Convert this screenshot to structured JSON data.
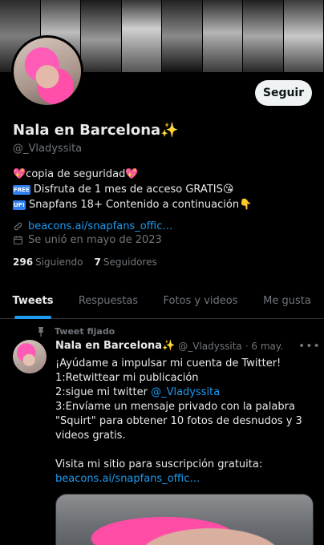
{
  "profile": {
    "name": "Nala en Barcelona✨",
    "handle": "@_Vladyssita",
    "follow_label": "Seguir",
    "bio": [
      {
        "text": "💖copia de seguridad💖"
      },
      {
        "tag": "FREE",
        "text": "Disfruta de 1 mes de acceso GRATIS😘"
      },
      {
        "tag": "UP!",
        "text": "Snapfans 18+ Contenido a continuación👇"
      }
    ],
    "link": "beacons.ai/snapfans_offic…",
    "joined": "Se unió en mayo de 2023",
    "following_count": "296",
    "following_label": "Siguiendo",
    "followers_count": "7",
    "followers_label": "Seguidores"
  },
  "tabs": [
    {
      "label": "Tweets",
      "active": true
    },
    {
      "label": "Respuestas"
    },
    {
      "label": "Fotos y videos"
    },
    {
      "label": "Me gusta"
    }
  ],
  "tweet": {
    "pinned_label": "Tweet fijado",
    "author_name": "Nala en Barcelona✨",
    "author_handle": "@_Vladyssita",
    "date": "· 6 may.",
    "more": "•••",
    "lines": {
      "l1": "¡Ayúdame a impulsar mi cuenta de Twitter!",
      "l2": "1:Retwittear mi publicación",
      "l3_prefix": "2:sigue mi twitter ",
      "l3_mention": "@_Vladyssita",
      "l4": "3:Envíame un mensaje privado con la palabra",
      "l5": "\"Squirt\" para obtener 10 fotos de desnudos y 3",
      "l6": "videos gratis.",
      "l7": "Visita mi sitio para suscripción gratuita:",
      "l8_link": "beacons.ai/snapfans_offic…"
    }
  },
  "colors": {
    "background": "#000000",
    "accent": "#1d9bf0",
    "secondary_text": "#71767b",
    "follow_button": "#eff3f4"
  },
  "icons": [
    "link-icon",
    "calendar-icon",
    "pin-icon",
    "more-icon"
  ]
}
